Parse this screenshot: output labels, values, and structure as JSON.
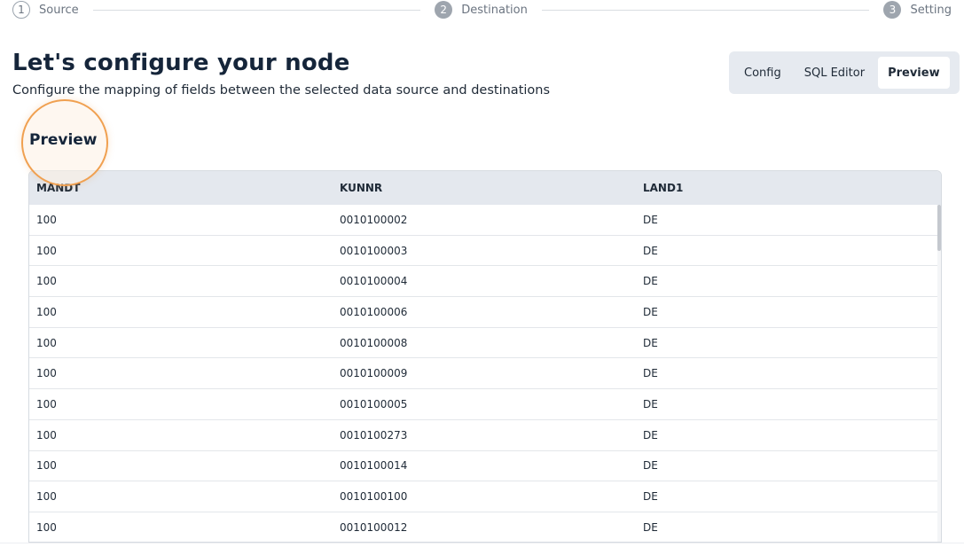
{
  "stepper": {
    "steps": [
      {
        "number": "1",
        "label": "Source"
      },
      {
        "number": "2",
        "label": "Destination"
      },
      {
        "number": "3",
        "label": "Setting"
      }
    ]
  },
  "header": {
    "title": "Let's configure your node",
    "subtitle": "Configure the mapping of fields between the selected data source and destinations"
  },
  "tabs": [
    {
      "label": "Config"
    },
    {
      "label": "SQL Editor"
    },
    {
      "label": "Preview"
    }
  ],
  "active_tab": "Preview",
  "section": {
    "title": "Preview"
  },
  "table": {
    "columns": [
      "MANDT",
      "KUNNR",
      "LAND1"
    ],
    "rows": [
      [
        "100",
        "0010100002",
        "DE"
      ],
      [
        "100",
        "0010100003",
        "DE"
      ],
      [
        "100",
        "0010100004",
        "DE"
      ],
      [
        "100",
        "0010100006",
        "DE"
      ],
      [
        "100",
        "0010100008",
        "DE"
      ],
      [
        "100",
        "0010100009",
        "DE"
      ],
      [
        "100",
        "0010100005",
        "DE"
      ],
      [
        "100",
        "0010100273",
        "DE"
      ],
      [
        "100",
        "0010100014",
        "DE"
      ],
      [
        "100",
        "0010100100",
        "DE"
      ],
      [
        "100",
        "0010100012",
        "DE"
      ]
    ]
  },
  "colors": {
    "highlight_ring": "#f0a050",
    "table_header_bg": "#e4e8ee",
    "tabs_bg": "#e6eaf0"
  }
}
